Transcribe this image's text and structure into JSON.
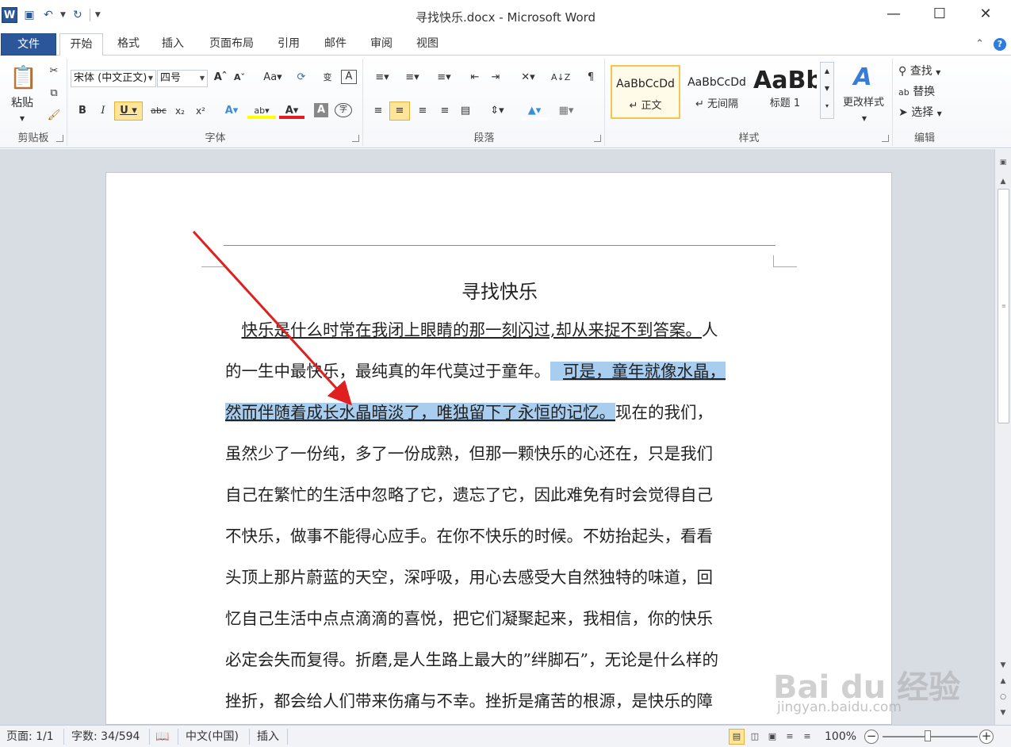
{
  "window": {
    "title": "寻找快乐.docx - Microsoft Word",
    "minimize": "—",
    "maximize": "☐",
    "close": "✕"
  },
  "tabs": [
    "文件",
    "开始",
    "格式",
    "插入",
    "页面布局",
    "引用",
    "邮件",
    "审阅",
    "视图"
  ],
  "ribbon": {
    "clipboard": {
      "label": "剪贴板",
      "paste": "粘贴"
    },
    "font": {
      "label": "字体",
      "font_name": "宋体 (中文正文)",
      "font_size": "四号"
    },
    "paragraph": {
      "label": "段落"
    },
    "styles": {
      "label": "样式",
      "items": [
        {
          "sample": "AaBbCcDd",
          "name": "↵ 正文"
        },
        {
          "sample": "AaBbCcDd",
          "name": "↵ 无间隔"
        },
        {
          "sample": "AaBb",
          "name": "标题 1"
        }
      ],
      "change_styles": "更改样式"
    },
    "editing": {
      "label": "编辑",
      "find": "查找",
      "replace": "替换",
      "select": "选择"
    }
  },
  "document": {
    "title": "寻找快乐",
    "lines": [
      {
        "a": "快乐是什么时常在我闭上眼睛的那一刻闪过,却从来捉不到答案。",
        "b": "人"
      },
      {
        "a": "的一生中最快乐，最纯真的年代莫过于童年。",
        "b": "可是，童年就像水晶，"
      },
      {
        "a": "然而伴随着成长水晶暗淡了，唯独留下了永恒的记忆。",
        "b": "现在的我们，"
      },
      {
        "a": "虽然少了一份纯，多了一份成熟，但那一颗快乐的心还在，只是我们"
      },
      {
        "a": "自己在繁忙的生活中忽略了它，遗忘了它，因此难免有时会觉得自己"
      },
      {
        "a": "不快乐，做事不能得心应手。在你不快乐的时候。不妨抬起头，看看"
      },
      {
        "a": "头顶上那片蔚蓝的天空，深呼吸，用心去感受大自然独特的味道，回"
      },
      {
        "a": "忆自己生活中点点滴滴的喜悦，把它们凝聚起来，我相信，你的快乐"
      },
      {
        "a": "必定会失而复得。折磨,是人生路上最大的”绊脚石”，无论是什么样的"
      },
      {
        "a": "挫折，都会给人们带来伤痛与不幸。挫折是痛苦的根源，是快乐的障"
      }
    ]
  },
  "status": {
    "page": "页面: 1/1",
    "words": "字数: 34/594",
    "language": "中文(中国)",
    "mode": "插入",
    "zoom": "100%"
  },
  "watermark": {
    "brand": "Bai du 经验",
    "url": "jingyan.baidu.com"
  },
  "colors": {
    "file_tab": "#2b579a",
    "selection": "#a8cdee",
    "arrow": "#e02020",
    "style_highlight": "#f4c54f"
  }
}
